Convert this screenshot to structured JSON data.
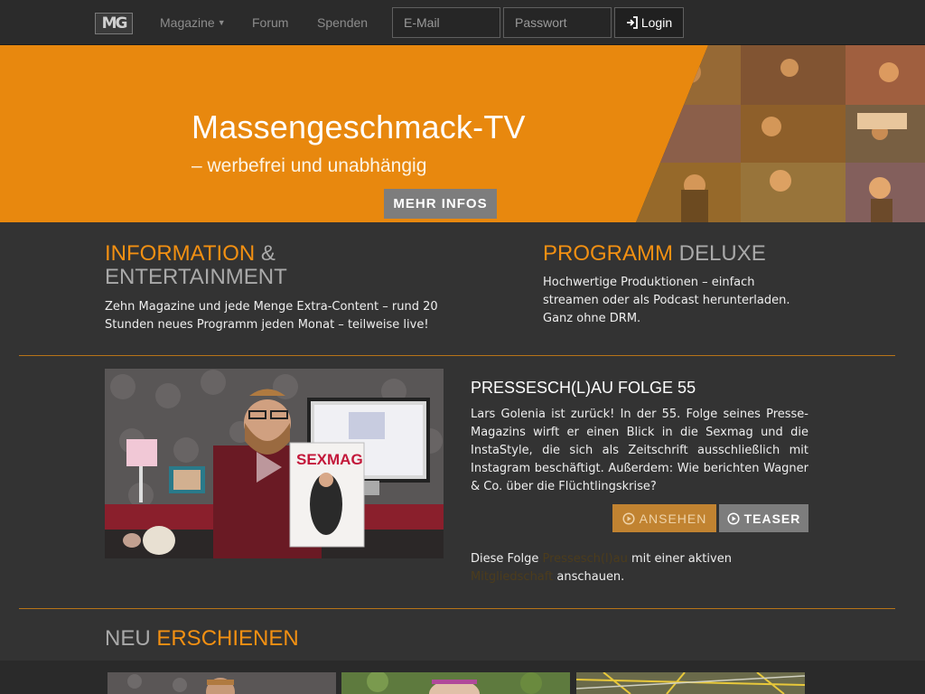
{
  "nav": {
    "logo": "MG",
    "magazine": "Magazine",
    "forum": "Forum",
    "spenden": "Spenden",
    "email_placeholder": "E-Mail",
    "password_placeholder": "Passwort",
    "login": "Login"
  },
  "hero": {
    "title": "Massengeschmack-TV",
    "subtitle": "– werbefrei und unabhängig",
    "button": "MEHR INFOS"
  },
  "features": {
    "left": {
      "title_orange": "INFORMATION",
      "title_gray": " & ENTERTAINMENT",
      "text": "Zehn Magazine und jede Menge Extra-Content – rund 20 Stunden neues Programm jeden Monat – teilweise live!"
    },
    "right": {
      "title_orange": "PROGRAMM",
      "title_gray": " DELUXE",
      "text": "Hochwertige Produktionen – einfach streamen oder als Podcast herunterladen. Ganz ohne DRM."
    }
  },
  "episode": {
    "title": "PRESSESCH(L)AU FOLGE 55",
    "description": "Lars Golenia ist zurück! In der 55. Folge seines Presse-Magazins wirft er einen Blick in die Sexmag und die InstaStyle, die sich als Zeitschrift ausschließlich mit Instagram beschäftigt. Außerdem: Wie berichten Wagner & Co. über die Flüchtlingskrise?",
    "watch_label": "ANSEHEN",
    "teaser_label": "TEASER",
    "note_prefix": "Diese Folge ",
    "note_link1": "Pressesch(l)au",
    "note_middle": " mit einer aktiven ",
    "note_link2": "Mitgliedschaft",
    "note_suffix": " anschauen.",
    "magazine_cover": "SEXMAG"
  },
  "new_section": {
    "title_gray": "NEU ",
    "title_orange": "ERSCHIENEN"
  },
  "colors": {
    "accent": "#f39012",
    "hero_bg": "#e8880e",
    "page_bg": "#333333",
    "navbar_bg": "#2b2b2b"
  }
}
